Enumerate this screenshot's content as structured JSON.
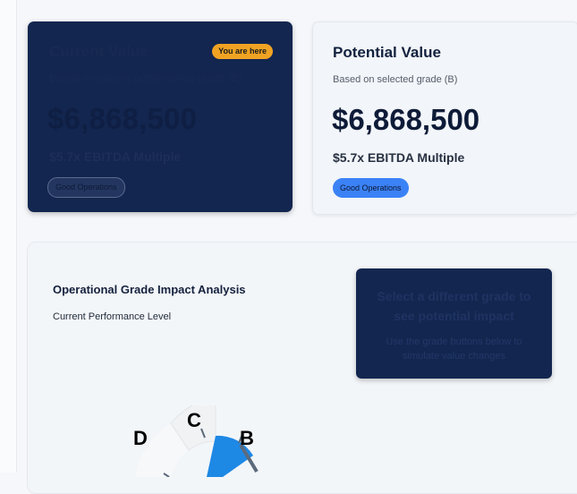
{
  "current_card": {
    "title": "Current Value",
    "subtitle": "Based on current performance grade (B)",
    "value": "$6,868,500",
    "multiple": "$5.7x EBITDA Multiple",
    "badge": "Good Operations",
    "you_are_here": "You are here"
  },
  "potential_card": {
    "title": "Potential Value",
    "subtitle": "Based on selected grade (B)",
    "value": "$6,868,500",
    "multiple": "$5.7x EBITDA Multiple",
    "badge": "Good Operations"
  },
  "analysis": {
    "title": "Operational Grade Impact Analysis",
    "subtitle": "Current Performance Level",
    "tooltip_title": "Select a different grade to see potential impact",
    "tooltip_body": "Use the grade buttons below to simulate value changes",
    "grades": [
      "D",
      "C",
      "B"
    ],
    "selected_grade": "B",
    "colors": {
      "selected": "#1e88e5",
      "navy": "#13264f",
      "accent": "#f0a323"
    }
  }
}
